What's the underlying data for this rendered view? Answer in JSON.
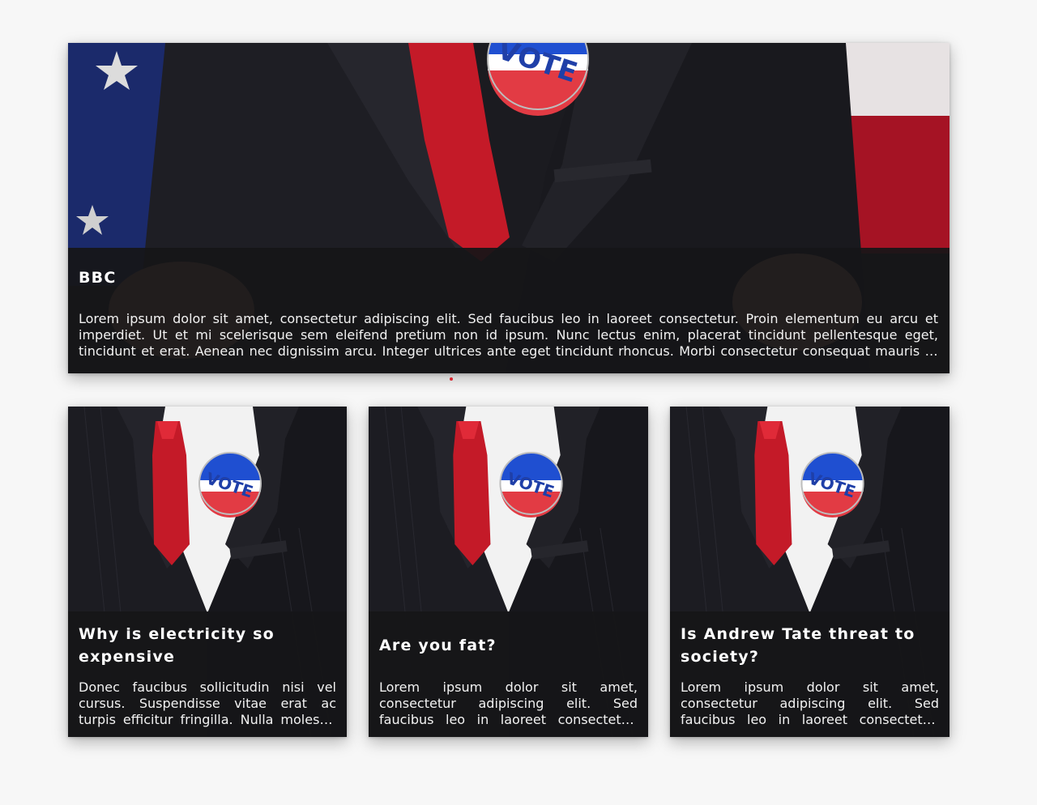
{
  "featured": {
    "title": "BBC",
    "text": "Lorem ipsum dolor sit amet, consectetur adipiscing elit. Sed faucibus leo in laoreet consectetur. Proin elementum eu arcu et imperdiet. Ut et mi scelerisque sem eleifend pretium non id ipsum. Nunc lectus enim, placerat tincidunt pellentesque eget, tincidunt et erat. Aenean nec dignissim arcu. Integer ultrices ante eget tincidunt rhoncus. Morbi consectetur consequat mauris ut sollicitudin. In hac habitasse platea dictumst."
  },
  "cards": [
    {
      "title": "Why is electricity so expensive",
      "text": "Donec faucibus sollicitudin nisi vel cursus. Suspendisse vitae erat ac turpis efficitur fringilla. Nulla molestie ligula et justo tincidunt."
    },
    {
      "title": "Are you fat?",
      "text": "Lorem ipsum dolor sit amet, consectetur adipiscing elit. Sed faucibus leo in laoreet consectetur. Proin elementum eu arcu et imperdiet."
    },
    {
      "title": "Is Andrew Tate threat to society?",
      "text": "Lorem ipsum dolor sit amet, consectetur adipiscing elit. Sed faucibus leo in laoreet consectetur. Proin elementum eu arcu et imperdiet."
    }
  ],
  "badge_text": "VOTE",
  "colors": {
    "accent": "#d9232e",
    "overlay": "#161618",
    "background": "#f7f7f7"
  }
}
